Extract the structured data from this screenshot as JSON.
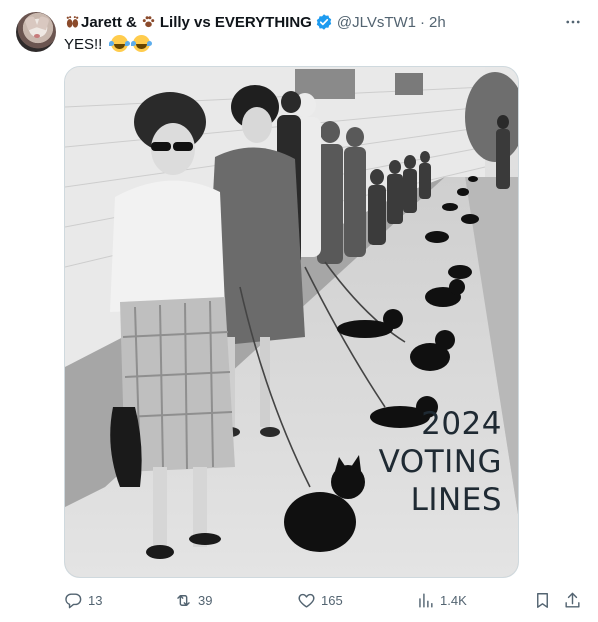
{
  "author": {
    "name_part1": "Jarett &",
    "name_part2": "Lilly vs EVERYTHING",
    "handle": "@JLVsTW1",
    "separator": "·",
    "time": "2h",
    "verified": true,
    "emoji_1": "feet",
    "emoji_2": "paw-prints"
  },
  "tweet": {
    "text": "YES!!",
    "emojis": [
      "face-with-tears-of-joy",
      "face-with-tears-of-joy"
    ]
  },
  "media": {
    "description_icon": "photo",
    "overlay_lines": [
      "2024",
      "VOTING",
      "LINES"
    ]
  },
  "actions": {
    "replies": "13",
    "reposts": "39",
    "likes": "165",
    "views": "1.4K"
  },
  "colors": {
    "text_primary": "#0f1419",
    "text_secondary": "#536471",
    "verified_blue": "#1d9bf0",
    "border": "#cfd9de"
  }
}
